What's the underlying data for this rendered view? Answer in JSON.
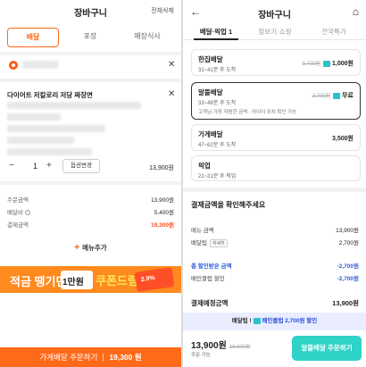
{
  "left": {
    "title": "장바구니",
    "clear_all": "전체삭제",
    "tabs": [
      "배달",
      "포장",
      "매장식사"
    ],
    "store_name": "다이어트 저칼로리 저당 짜장면",
    "quantity": "1",
    "option_change": "옵션변경",
    "item_price": "13,900원",
    "summary": [
      {
        "label": "주문금액",
        "value": "13,900원"
      },
      {
        "label": "배달비",
        "value": "5,400원"
      },
      {
        "label": "결제금액",
        "value": "19,300원"
      }
    ],
    "add_menu": "메뉴추가",
    "banner": {
      "left": "적금 땡기면",
      "coupon": "1만원",
      "right": "쿠폰드림!",
      "card": "2.9%"
    },
    "order_button": {
      "label": "가게배달 주문하기",
      "price": "19,300 원"
    },
    "colors": {
      "accent": "#ff6a1a"
    }
  },
  "right": {
    "title": "장바구니",
    "tabs": [
      "배달·픽업 1",
      "장보기·쇼핑",
      "전국특가"
    ],
    "options": [
      {
        "name": "한집배달",
        "time": "31~41분 후 도착",
        "strike": "3,700원",
        "price": "1,000원"
      },
      {
        "name": "알뜰배달",
        "time": "33~48분 후 도착",
        "strike": "2,700원",
        "price": "무료",
        "desc": "고객님 가장 저렴한 금액 · 라이더 위치 확인 가능"
      },
      {
        "name": "가게배달",
        "time": "47~62분 후 도착",
        "price": "3,500원"
      },
      {
        "name": "픽업",
        "time": "21~31분 후 픽업"
      }
    ],
    "section_title": "결제금액을 확인해주세요",
    "rows": [
      {
        "label": "메뉴 금액",
        "value": "13,900원"
      },
      {
        "label": "배달팁",
        "tag": "자세히",
        "value": "2,700원"
      },
      {
        "label": "총 할인받은 금액",
        "value": "-2,700원"
      },
      {
        "label": "배민클럽 할인",
        "value": "-2,700원"
      }
    ],
    "total": {
      "label": "결제예정금액",
      "value": "13,900원"
    },
    "promo": {
      "prefix": "배달팁",
      "mid": "배민클럽",
      "amount": "2,700원 할인"
    },
    "footer": {
      "price": "13,900원",
      "strike": "16,600원",
      "note": "주문 가능"
    },
    "order_button": "알뜰배달 주문하기",
    "colors": {
      "accent": "#2fd3c8",
      "discount": "#2d5ed8"
    }
  }
}
